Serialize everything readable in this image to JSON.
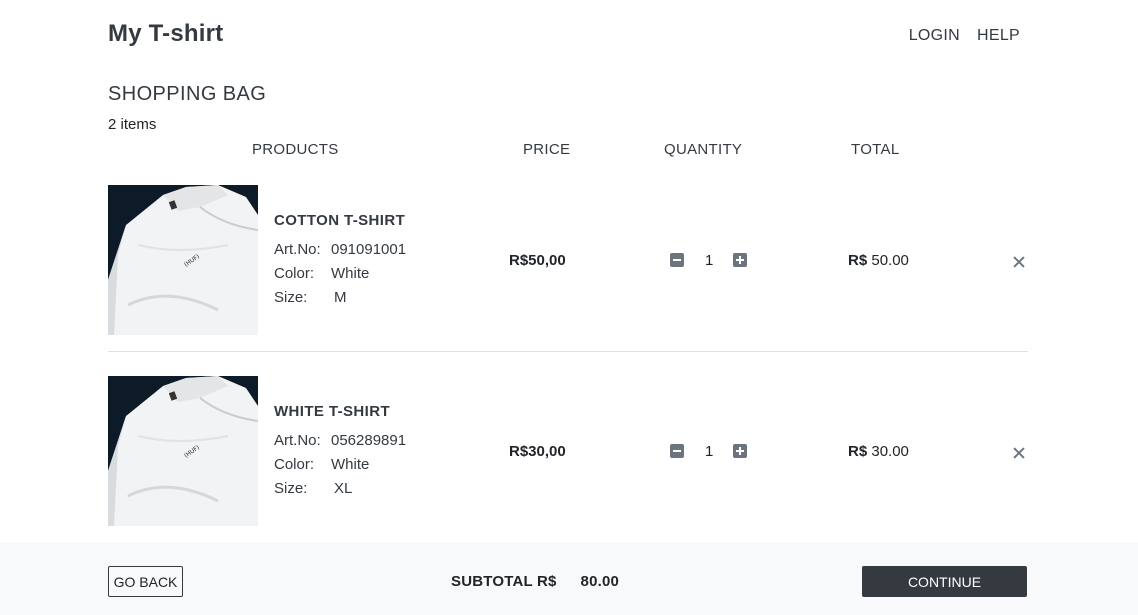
{
  "header": {
    "brand": "My T-shirt",
    "nav": [
      "LOGIN",
      "HELP"
    ]
  },
  "bag": {
    "title": "SHOPPING BAG",
    "count": "2 items",
    "columns": [
      "PRODUCTS",
      "PRICE",
      "QUANTITY",
      "TOTAL"
    ],
    "items": [
      {
        "name": "COTTON T-SHIRT",
        "art_label": "Art.No:",
        "art": "091091001",
        "color_label": "Color:",
        "color": "White",
        "size_label": "Size:",
        "size": "M",
        "price": "R$50,00",
        "qty": "1",
        "total_currency": "R$",
        "total_value": "50.00"
      },
      {
        "name": "WHITE T-SHIRT",
        "art_label": "Art.No:",
        "art": "056289891",
        "color_label": "Color:",
        "color": "White",
        "size_label": "Size:",
        "size": "XL",
        "price": "R$30,00",
        "qty": "1",
        "total_currency": "R$",
        "total_value": "30.00"
      }
    ]
  },
  "footer": {
    "back": "GO BACK",
    "subtotal_label": "SUBTOTAL R$",
    "subtotal_value": "80.00",
    "continue": "CONTINUE"
  },
  "colors": {
    "dark": "#343a40",
    "footer_bg": "#f8f9fa",
    "icon_gray": "#6c757d"
  },
  "icons": [
    "minus-square-icon",
    "plus-square-icon",
    "close-icon"
  ]
}
